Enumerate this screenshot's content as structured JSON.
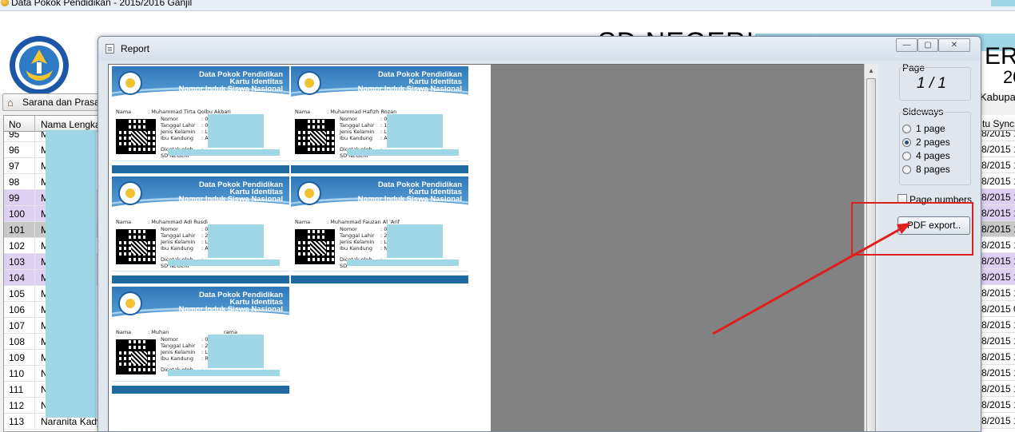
{
  "main_window": {
    "title": "Data Pokok Pendidikan - 2015/2016 Ganjil",
    "school_name": "SD NEGERI",
    "header_right_big": "20",
    "header_right_er": "ER",
    "header_right_kab": "Kabupa",
    "tab_label": "Sarana dan Prasar",
    "grid": {
      "col_no": "No",
      "col_name": "Nama Lengka",
      "rows": [
        {
          "no": "95",
          "name": "M"
        },
        {
          "no": "96",
          "name": "M"
        },
        {
          "no": "97",
          "name": "M"
        },
        {
          "no": "98",
          "name": "M"
        },
        {
          "no": "99",
          "name": "M"
        },
        {
          "no": "100",
          "name": "M"
        },
        {
          "no": "101",
          "name": "M"
        },
        {
          "no": "102",
          "name": "M"
        },
        {
          "no": "103",
          "name": "M"
        },
        {
          "no": "104",
          "name": "M"
        },
        {
          "no": "105",
          "name": "M"
        },
        {
          "no": "106",
          "name": "M"
        },
        {
          "no": "107",
          "name": "M"
        },
        {
          "no": "108",
          "name": "M"
        },
        {
          "no": "109",
          "name": "M"
        },
        {
          "no": "110",
          "name": "N"
        },
        {
          "no": "111",
          "name": "N"
        },
        {
          "no": "112",
          "name": "N"
        },
        {
          "no": "113",
          "name": "Naranita Kady"
        }
      ],
      "row_colors": [
        "#ffffff",
        "#ffffff",
        "#ffffff",
        "#ffffff",
        "#ded0f2",
        "#ded0f2",
        "#c8c8c8",
        "#ffffff",
        "#ded0f2",
        "#ded0f2",
        "#ffffff",
        "#ffffff",
        "#ffffff",
        "#ffffff",
        "#ffffff",
        "#ffffff",
        "#ffffff",
        "#ffffff",
        "#ffffff"
      ]
    },
    "right_grid": {
      "col": "tu Sync",
      "rows": [
        "8/2015 1",
        "8/2015 1",
        "8/2015 1",
        "8/2015 1",
        "8/2015 1",
        "8/2015 1",
        "8/2015 1",
        "8/2015 1",
        "8/2015 1",
        "8/2015 1",
        "8/2015 1",
        "8/2015 0",
        "8/2015 1",
        "8/2015 1",
        "8/2015 1",
        "8/2015 1",
        "8/2015 1",
        "8/2015 1",
        "8/2015 1"
      ]
    }
  },
  "report_dialog": {
    "title": "Report",
    "window_buttons": {
      "minimize": "—",
      "maximize": "▢",
      "close": "✕"
    },
    "page_group": {
      "label": "Page",
      "value": "1 / 1"
    },
    "sideways": {
      "label": "Sideways",
      "options": [
        "1 page",
        "2 pages",
        "4 pages",
        "8 pages"
      ],
      "selected_index": 1
    },
    "page_numbers_label": "Page numbers",
    "page_numbers_checked": false,
    "pdf_export_label": "PDF export..",
    "cards": [
      {
        "title1": "Data Pokok Pendidikan",
        "title2": "Kartu Identitas",
        "title3": "Nomor Induk Siswa Nasional",
        "name_label": "Nama",
        "name_value": ": Muhammad Tirta Qolbu Akbari",
        "nomor_label": "Nomor",
        "nomor_value": ": 00",
        "tgl_label": "Tanggal Lahir",
        "tgl_value": ": 0",
        "jk_label": "Jenis Kelamin",
        "jk_value": ": L",
        "ibu_label": "Ibu Kandung",
        "ibu_value": ": A",
        "dicetak_label": "Dicetak oleh",
        "dicetak_value": ":",
        "sekolah": "SD NEGERI"
      },
      {
        "title1": "Data Pokok Pendidikan",
        "title2": "Kartu Identitas",
        "title3": "Nomor Induk Siswa Nasional",
        "name_label": "Nama",
        "name_value": ": Muhammad Hafizh Rozan",
        "nomor_label": "Nomor",
        "nomor_value": ": 0",
        "tgl_label": "Tanggal Lahir",
        "tgl_value": ": 1",
        "jk_label": "Jenis Kelamin",
        "jk_value": ": L",
        "ibu_label": "Ibu Kandung",
        "ibu_value": ": A",
        "dicetak_label": "Dicetak oleh",
        "dicetak_value": ":",
        "sekolah": "SD NEGERI"
      },
      {
        "title1": "Data Pokok Pendidikan",
        "title2": "Kartu Identitas",
        "title3": "Nomor Induk Siswa Nasional",
        "name_label": "Nama",
        "name_value": ": Muhammad Adi Rusdi",
        "nomor_label": "Nomor",
        "nomor_value": ": 0",
        "tgl_label": "Tanggal Lahir",
        "tgl_value": ": 2",
        "jk_label": "Jenis Kelamin",
        "jk_value": ": L",
        "ibu_label": "Ibu Kandung",
        "ibu_value": ": A",
        "dicetak_label": "Dicetak oleh",
        "dicetak_value": ":",
        "sekolah": "SD NEGERI"
      },
      {
        "title1": "Data Pokok Pendidikan",
        "title2": "Kartu Identitas",
        "title3": "Nomor Induk Siswa Nasional",
        "name_label": "Nama",
        "name_value": ": Muhammad Fauzan Al 'Arif",
        "nomor_label": "Nomor",
        "nomor_value": ": 00",
        "tgl_label": "Tanggal Lahir",
        "tgl_value": ": 23",
        "jk_label": "Jenis Kelamin",
        "jk_value": ": La",
        "ibu_label": "Ibu Kandung",
        "ibu_value": ": Ne",
        "dicetak_label": "Dicetak oleh",
        "dicetak_value": ":",
        "sekolah": "SD"
      },
      {
        "title1": "Data Pokok Pendidikan",
        "title2": "Kartu Identitas",
        "title3": "Nomor Induk Siswa Nasional",
        "name_label": "Nama",
        "name_value": ": Muhan",
        "name_tail": "rama",
        "nomor_label": "Nomor",
        "nomor_value": ": 005",
        "tgl_label": "Tanggal Lahir",
        "tgl_value": ": 24-",
        "jk_label": "Jenis Kelamin",
        "jk_value": ": Lak",
        "ibu_label": "Ibu Kandung",
        "ibu_value": ": Rin",
        "ibu_tail": "ri",
        "dicetak_label": "Dicetak oleh",
        "dicetak_value": ":",
        "sekolah": ""
      }
    ]
  },
  "colors": {
    "redaction": "#9fd7e6",
    "annotation": "#e01e1e",
    "card_blue": "#1f6aa0",
    "preview_bg": "#828282"
  }
}
